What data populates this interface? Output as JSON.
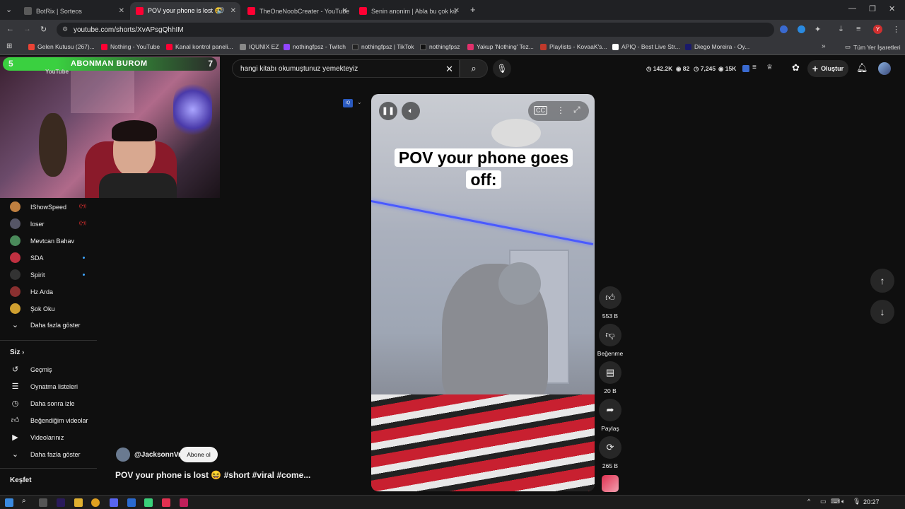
{
  "browser": {
    "tabs": [
      {
        "title": "BotRix | Sorteos",
        "color": "#5a5a5a"
      },
      {
        "title": "POV your phone is lost 😆",
        "color": "#ff0033"
      },
      {
        "title": "TheOneNoobCreater - YouTube",
        "color": "#ff0033"
      },
      {
        "title": "Senin anonim | Abla bu çok kü",
        "color": "#ff0033"
      }
    ],
    "url": "youtube.com/shorts/XvAPsgQhhIM",
    "bookmarks": [
      {
        "label": "Gelen Kutusu (267)...",
        "color": "#ea4335"
      },
      {
        "label": "Nothing - YouTube",
        "color": "#ff0033"
      },
      {
        "label": "Kanal kontrol paneli...",
        "color": "#ff0033"
      },
      {
        "label": "IQUNIX EZ",
        "color": "#888888"
      },
      {
        "label": "nothingfpsz - Twitch",
        "color": "#9146ff"
      },
      {
        "label": "nothingfpsz | TikTok",
        "color": "#222222"
      },
      {
        "label": "nothingfpsz",
        "color": "#111111"
      },
      {
        "label": "Yakup 'Nothing' Tez...",
        "color": "#e1306c"
      },
      {
        "label": "Playlists - KovaaK's...",
        "color": "#c0392b"
      },
      {
        "label": "APIQ - Best Live Str...",
        "color": "#ffffff"
      },
      {
        "label": "Diego Moreira - Oy...",
        "color": "#1a1a6a"
      }
    ],
    "all_bookmarks": "Tüm Yer İşaretleri"
  },
  "header": {
    "search_query": "hangi kitabı okumuştunuz yemekteyiz",
    "stats": [
      {
        "icon": "clock-icon",
        "value": "142.2K"
      },
      {
        "icon": "eye-icon",
        "value": "82"
      },
      {
        "icon": "clock-icon",
        "value": "7,245"
      },
      {
        "icon": "eye-icon",
        "value": "15K"
      }
    ],
    "create_label": "Oluştur"
  },
  "overlay": {
    "subscribe_goal_label": "ABONMAN BUROM",
    "goal_left": "5",
    "goal_right": "7",
    "channel_small": "YouTube"
  },
  "sidebar": {
    "subscriptions": [
      {
        "name": "IShowSpeed",
        "color": "#c08040",
        "live": true
      },
      {
        "name": "loser",
        "color": "#555566",
        "live": true
      },
      {
        "name": "Mevtcan Bahav",
        "color": "#4a8a5a",
        "live": false
      },
      {
        "name": "SDA",
        "color": "#c03040",
        "live": false,
        "dot": true
      },
      {
        "name": "Spirit",
        "color": "#333333",
        "live": false,
        "dot": true
      },
      {
        "name": "Hz Arda",
        "color": "#8a3030",
        "live": false
      },
      {
        "name": "Şok Oku",
        "color": "#d0a030",
        "live": false
      }
    ],
    "show_more": "Daha fazla göster",
    "you_section": "Siz",
    "you_items": [
      {
        "label": "Geçmiş",
        "icon": "history-icon"
      },
      {
        "label": "Oynatma listeleri",
        "icon": "playlist-icon"
      },
      {
        "label": "Daha sonra izle",
        "icon": "clock-icon"
      },
      {
        "label": "Beğendiğim videolar",
        "icon": "thumbs-up-icon"
      },
      {
        "label": "Videolarınız",
        "icon": "video-icon"
      }
    ],
    "show_more_2": "Daha fazla göster",
    "explore": "Keşfet"
  },
  "short": {
    "caption": "POV your phone goes off:",
    "channel": "@JacksonnVr",
    "subscribe_label": "Abone ol",
    "title": "POV your phone is lost 😆 #short #viral #come..."
  },
  "actions": {
    "likes": "553 B",
    "dislike_label": "Beğenme",
    "comments": "20 B",
    "share_label": "Paylaş",
    "remix": "265 B"
  },
  "taskbar": {
    "clock": "20:27"
  }
}
